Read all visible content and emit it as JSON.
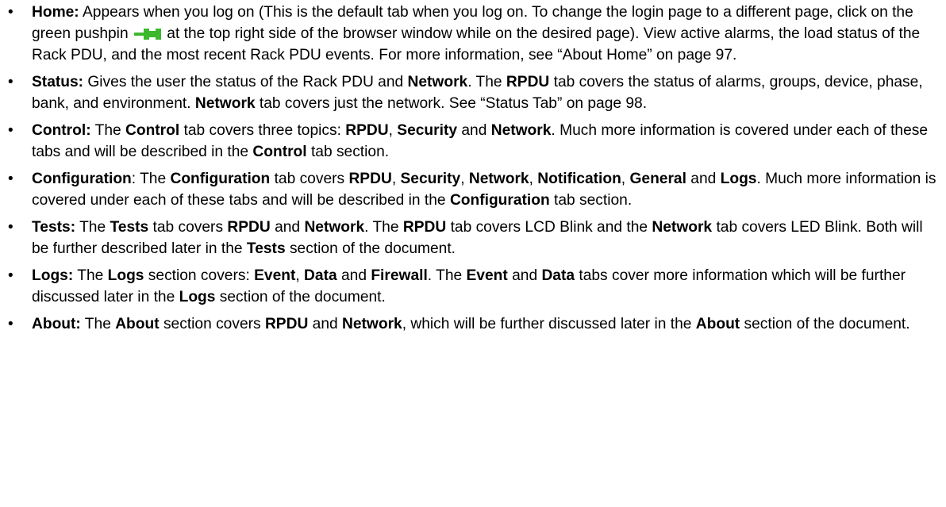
{
  "bullet_char": "•",
  "pushpin_icon": {
    "name": "green-pushpin-icon",
    "color": "#3cb82e"
  },
  "items": [
    {
      "runs": [
        {
          "t": "Home:",
          "b": true
        },
        {
          "t": " Appears when you log on (This is the default tab when you log on. To change the login page to a different page, click on the green pushpin "
        },
        {
          "icon": "green-pushpin-icon"
        },
        {
          "t": " at the top right side of the browser window while on the desired page). View active alarms, the load status of the Rack PDU, and the most recent Rack PDU events. For more information, see “About Home” on page 97."
        }
      ]
    },
    {
      "runs": [
        {
          "t": "Status:",
          "b": true
        },
        {
          "t": " Gives the user the status of the Rack PDU and "
        },
        {
          "t": "Network",
          "b": true
        },
        {
          "t": ". The "
        },
        {
          "t": "RPDU",
          "b": true
        },
        {
          "t": " tab covers the status of alarms, groups, device, phase, bank, and environment. "
        },
        {
          "t": "Network",
          "b": true
        },
        {
          "t": " tab covers just the network. See “Status Tab” on page 98."
        }
      ]
    },
    {
      "runs": [
        {
          "t": "Control:",
          "b": true
        },
        {
          "t": " The "
        },
        {
          "t": "Control",
          "b": true
        },
        {
          "t": " tab covers three topics: "
        },
        {
          "t": "RPDU",
          "b": true
        },
        {
          "t": ", "
        },
        {
          "t": "Security",
          "b": true
        },
        {
          "t": " and "
        },
        {
          "t": "Network",
          "b": true
        },
        {
          "t": ". Much more information is covered under each of these tabs and will be described in the "
        },
        {
          "t": "Control",
          "b": true
        },
        {
          "t": " tab section."
        }
      ]
    },
    {
      "runs": [
        {
          "t": "Configuration",
          "b": true
        },
        {
          "t": ": The "
        },
        {
          "t": "Configuration",
          "b": true
        },
        {
          "t": " tab covers "
        },
        {
          "t": "RPDU",
          "b": true
        },
        {
          "t": ", "
        },
        {
          "t": "Security",
          "b": true
        },
        {
          "t": ", "
        },
        {
          "t": "Network",
          "b": true
        },
        {
          "t": ", "
        },
        {
          "t": "Notification",
          "b": true
        },
        {
          "t": ", "
        },
        {
          "t": "General",
          "b": true
        },
        {
          "t": " and "
        },
        {
          "t": "Logs",
          "b": true
        },
        {
          "t": ". Much more information is covered under each of these tabs and will be described in the "
        },
        {
          "t": "Configuration",
          "b": true
        },
        {
          "t": " tab section."
        }
      ]
    },
    {
      "runs": [
        {
          "t": "Tests:",
          "b": true
        },
        {
          "t": " The "
        },
        {
          "t": "Tests",
          "b": true
        },
        {
          "t": " tab covers "
        },
        {
          "t": "RPDU",
          "b": true
        },
        {
          "t": " and "
        },
        {
          "t": "Network",
          "b": true
        },
        {
          "t": ". The "
        },
        {
          "t": "RPDU",
          "b": true
        },
        {
          "t": " tab covers LCD Blink and the "
        },
        {
          "t": "Network",
          "b": true
        },
        {
          "t": " tab covers LED Blink. Both will be further described later in the "
        },
        {
          "t": "Tests",
          "b": true
        },
        {
          "t": " section of the document."
        }
      ]
    },
    {
      "runs": [
        {
          "t": "Logs:",
          "b": true
        },
        {
          "t": " The "
        },
        {
          "t": "Logs",
          "b": true
        },
        {
          "t": " section covers: "
        },
        {
          "t": "Event",
          "b": true
        },
        {
          "t": ", "
        },
        {
          "t": "Data",
          "b": true
        },
        {
          "t": " and "
        },
        {
          "t": "Firewall",
          "b": true
        },
        {
          "t": ". The "
        },
        {
          "t": "Event",
          "b": true
        },
        {
          "t": " and "
        },
        {
          "t": "Data",
          "b": true
        },
        {
          "t": " tabs cover more information which will be further discussed later in the "
        },
        {
          "t": "Logs",
          "b": true
        },
        {
          "t": " section of the document."
        }
      ]
    },
    {
      "runs": [
        {
          "t": "About:",
          "b": true
        },
        {
          "t": " The "
        },
        {
          "t": "About",
          "b": true
        },
        {
          "t": " section covers "
        },
        {
          "t": "RPDU",
          "b": true
        },
        {
          "t": " and "
        },
        {
          "t": "Network",
          "b": true
        },
        {
          "t": ", which will be further discussed later in the "
        },
        {
          "t": "About",
          "b": true
        },
        {
          "t": " section of the document."
        }
      ]
    }
  ]
}
